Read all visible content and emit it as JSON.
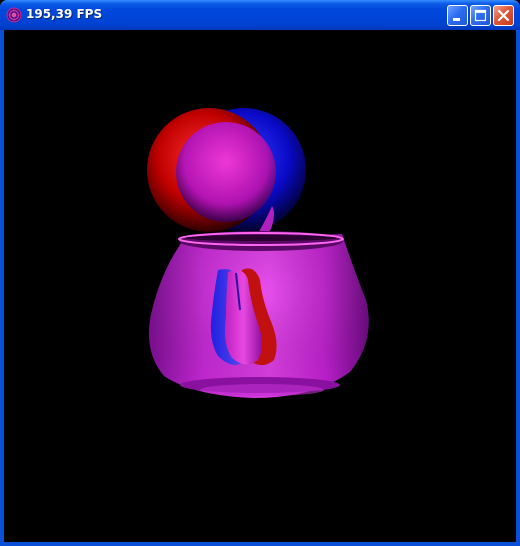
{
  "window": {
    "title": "195,39 FPS",
    "icon": "opengl-app-icon"
  },
  "titlebar_buttons": {
    "minimize": "minimize-icon",
    "maximize": "maximize-icon",
    "close": "close-icon"
  },
  "scene": {
    "description_objects": [
      "sphere",
      "teapot",
      "pear"
    ],
    "render_mode": "anaglyph-red-blue"
  }
}
